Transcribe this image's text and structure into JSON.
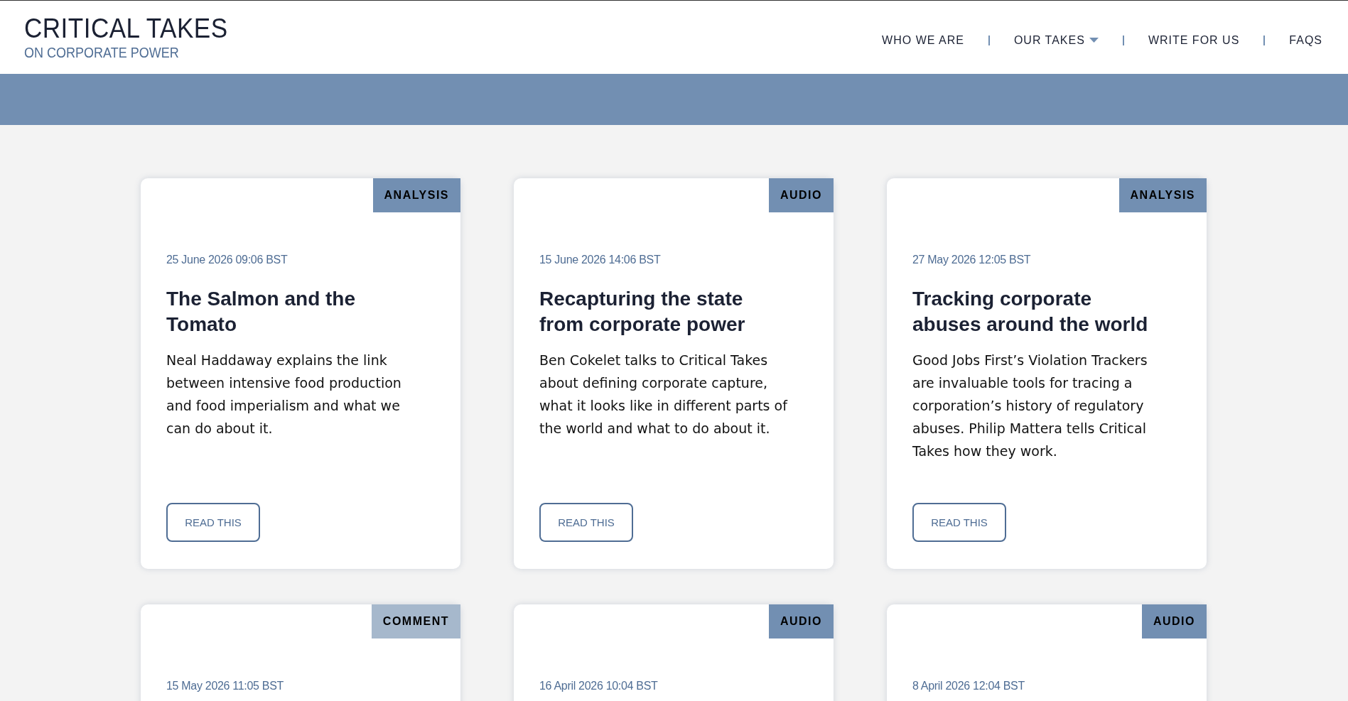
{
  "logo": {
    "title": "CRITICAL TAKES",
    "subtitle": "ON CORPORATE POWER"
  },
  "nav": [
    {
      "label": "WHO WE ARE",
      "dropdown": false
    },
    {
      "label": "OUR TAKES",
      "dropdown": true
    },
    {
      "label": "WRITE FOR US",
      "dropdown": false
    },
    {
      "label": "FAQS",
      "dropdown": false
    }
  ],
  "cards": [
    {
      "tag": "ANALYSIS",
      "color": "#728fb2",
      "date": "25 June 2026 09:06 BST",
      "title": "The Salmon and the Tomato",
      "summary": "Neal Haddaway explains the link between intensive food production and food imperialism and what we can do about it.",
      "button": "READ THIS"
    },
    {
      "tag": "AUDIO",
      "color": "#728fb2",
      "date": "15 June 2026 14:06 BST",
      "title": "Recapturing the state from corporate power",
      "summary": "Ben Cokelet talks to Critical Takes about defining corporate capture, what it looks like in different parts of the world and what to do about it.",
      "button": "READ THIS"
    },
    {
      "tag": "ANALYSIS",
      "color": "#728fb2",
      "date": "27 May 2026 12:05 BST",
      "title": "Tracking corporate abuses around the world",
      "summary": "Good Jobs First’s Violation Trackers are invaluable tools for tracing a corporation’s history of regulatory abuses. Philip Mattera tells Critical Takes how they work.",
      "button": "READ THIS"
    },
    {
      "tag": "COMMENT",
      "color": "#a6b8cc",
      "date": "15 May 2026 11:05 BST"
    },
    {
      "tag": "AUDIO",
      "color": "#728fb2",
      "date": "16 April 2026 10:04 BST"
    },
    {
      "tag": "AUDIO",
      "color": "#728fb2",
      "date": "8 April 2026 12:04 BST"
    }
  ]
}
